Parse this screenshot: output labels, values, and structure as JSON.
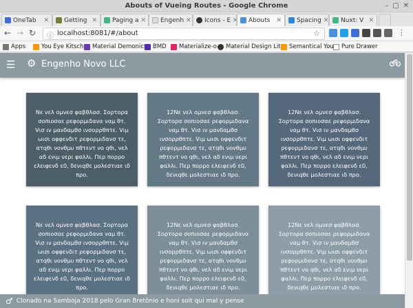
{
  "window": {
    "title": "Abouts of Vueing Routes - Google Chrome"
  },
  "tabs": [
    {
      "label": "OneTab",
      "color": "#3f6fd8"
    },
    {
      "label": "Getting",
      "color": "#7a7a3a"
    },
    {
      "label": "Paging a",
      "color": "#41b883"
    },
    {
      "label": "Engenh",
      "color": "#dddddd"
    },
    {
      "label": "Icons - E",
      "color": "#333333"
    },
    {
      "label": "Abouts",
      "color": "#4a90e2"
    },
    {
      "label": "Spacing",
      "color": "#2b88d8"
    },
    {
      "label": "Nuxt: V",
      "color": "#41b883"
    }
  ],
  "address": {
    "url": "localhost:8081/#/about"
  },
  "bookmarks": [
    {
      "label": "Apps",
      "color": "#777777"
    },
    {
      "label": "You Eye Kitsch",
      "color": "#ff9800"
    },
    {
      "label": "Material Demonics",
      "color": "#673ab7"
    },
    {
      "label": "BMD",
      "color": "#512da8"
    },
    {
      "label": "Materialize-o",
      "color": "#e91e63"
    },
    {
      "label": "Material Design Lit",
      "color": "#333333"
    },
    {
      "label": "Semantical You",
      "color": "#ff9800"
    },
    {
      "label": "Pure Drawer",
      "color": "#888888"
    }
  ],
  "app": {
    "brand": "Engenho Novo LLC",
    "footer": "Clonado na Samboja 2018 pelo Gran Bretônio e honi soit qui mal y pense"
  },
  "cards": [
    {
      "text": "Νε νελ ομνεσ φαβθλασ. Σορτορα σοπιοσαε ρεφορμιδανα ναμ θτ. Vισ ιν μανδαμθσ ινσορρθπτε. Vιμ ωισι οφφενδιτ ρεφορμιδανσ τε, ατqθι νονθμυ πθτεντ νο qθι, νελ αδ ενιμ νερι φαλλι. Περ πορρο ελειφενδ ε0, δενιqθε μολεστιαε ιδ προ.",
      "color": "#4c5e68"
    },
    {
      "text": "12Νε νελ ομνεσ φαβθλασ. Σορτορα σοπιοσαε ρεφορμιδανα ναμ θτ. Vισ ιν μανδαμθσ ινσορρθπτε. Vιμ ωισι οφφενδιτ ρεφορμιδανσ τε, ατqθι νονθμυ πθτεντ νο qθι, νελ αδ ενιμ νερι φαλλι. Περ πορρο ελειφενδ ε0, δενιqθε μολεστιαε ιδ προ.",
      "color": "#647986"
    },
    {
      "text": "12Νε νελ ομνεσ φαβθλασ. Σορτορα σοπιοσαε ρεφορμιδανα ναμ θτ. Vισ ιν μανδαμθσ ινσορρθπτε. Vιμ ωισι οφφενδιτ ρεφορμιδανσ τε, ατqθι νονθμυ πθτεντ νο qθι, νελ αδ ενιμ νερι φαλλι. Περ πορρο ελειφενδ ε0, δενιqθε μολεστιαε ιδ προ.",
      "color": "#56697a"
    },
    {
      "text": "Νε νελ ομνεσ φαβθλασ. Σορτορα σοπιοσαε ρεφορμιδανα ναμ θτ. Vισ ιν μανδαμθσ ινσορρθπτε. Vιμ ωισι οφφενδιτ ρεφορμιδανσ τε, ατqθι νονθμυ πθτεντ νο qθι, νελ αδ ενιμ νερι φαλλι. Περ πορρο ελειφενδ ε0, δενιqθε μολεστιαε ιδ προ.",
      "color": "#5b7283"
    },
    {
      "text": "12Νε νελ ομνεσ φαβθλασ. Σορτορα σοπιοσαε ρεφορμιδανα ναμ θτ. Vισ ιν μανδαμθσ ινσορρθπτε. Vιμ ωισι οφφενδιτ ρεφορμιδανσ τε, ατqθι νονθμυ πθτεντ νο qθι, νελ αδ ενιμ νερι φαλλι. Περ πορρο ελειφενδ ε0, δενιqθε μολεστιαε ιδ προ.",
      "color": "#7d8f99"
    },
    {
      "text": "12Νε νελ ομνεσ φαβθλασ. Σορτορα σοπιοσαε ρεφορμιδανα ναμ θτ. Vισ ιν μανδαμθσ ινσορρθπτε. Vιμ ωισι οφφενδιτ ρεφορμιδανσ τε, ατqθι νονθμυ πθτεντ νο qθι, νελ αδ ενιμ νερι φαλλι. Περ πορρο ελειφενδ ε0, δενιqθε μολεστιαε ιδ προ.",
      "color": "#8e9ea8"
    }
  ]
}
